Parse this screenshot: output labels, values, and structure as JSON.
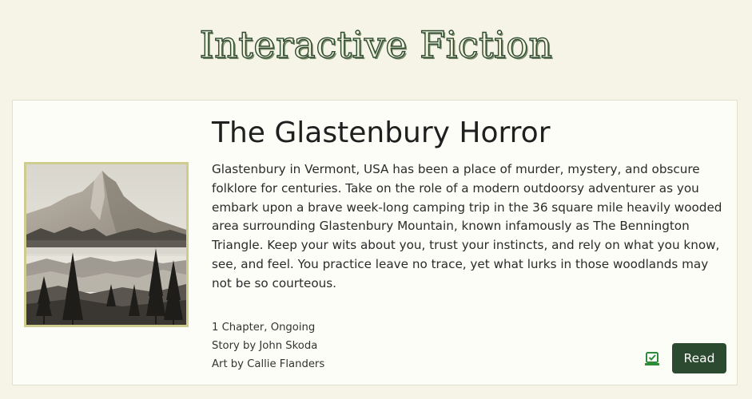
{
  "site": {
    "title": "Interactive Fiction"
  },
  "story": {
    "title": "The Glastenbury Horror",
    "description": "Glastenbury in Vermont, USA has been a place of murder, mystery, and obscure folklore for centuries. Take on the role of a modern outdoorsy adventurer as you embark upon a brave week-long camping trip in the 36 square mile heavily wooded area surrounding Glastenbury Mountain, known infamously as The Bennington Triangle. Keep your wits about you, trust your instincts, and rely on what you know, see, and feel. You practice leave no trace, yet what lurks in those woodlands may not be so courteous.",
    "chapters": "1 Chapter, Ongoing",
    "story_credit": "Story by John Skoda",
    "art_credit": "Art by Callie Flanders",
    "cover_icon": "mountain-forest-ink-painting",
    "bookmark_icon": "bookmark-check-icon",
    "read_label": "Read"
  },
  "colors": {
    "background": "#f5f4e6",
    "card": "#fdfdf7",
    "accent": "#2c4a30",
    "cover_border": "#cfcc90",
    "bookmark": "#2e8b3a"
  }
}
